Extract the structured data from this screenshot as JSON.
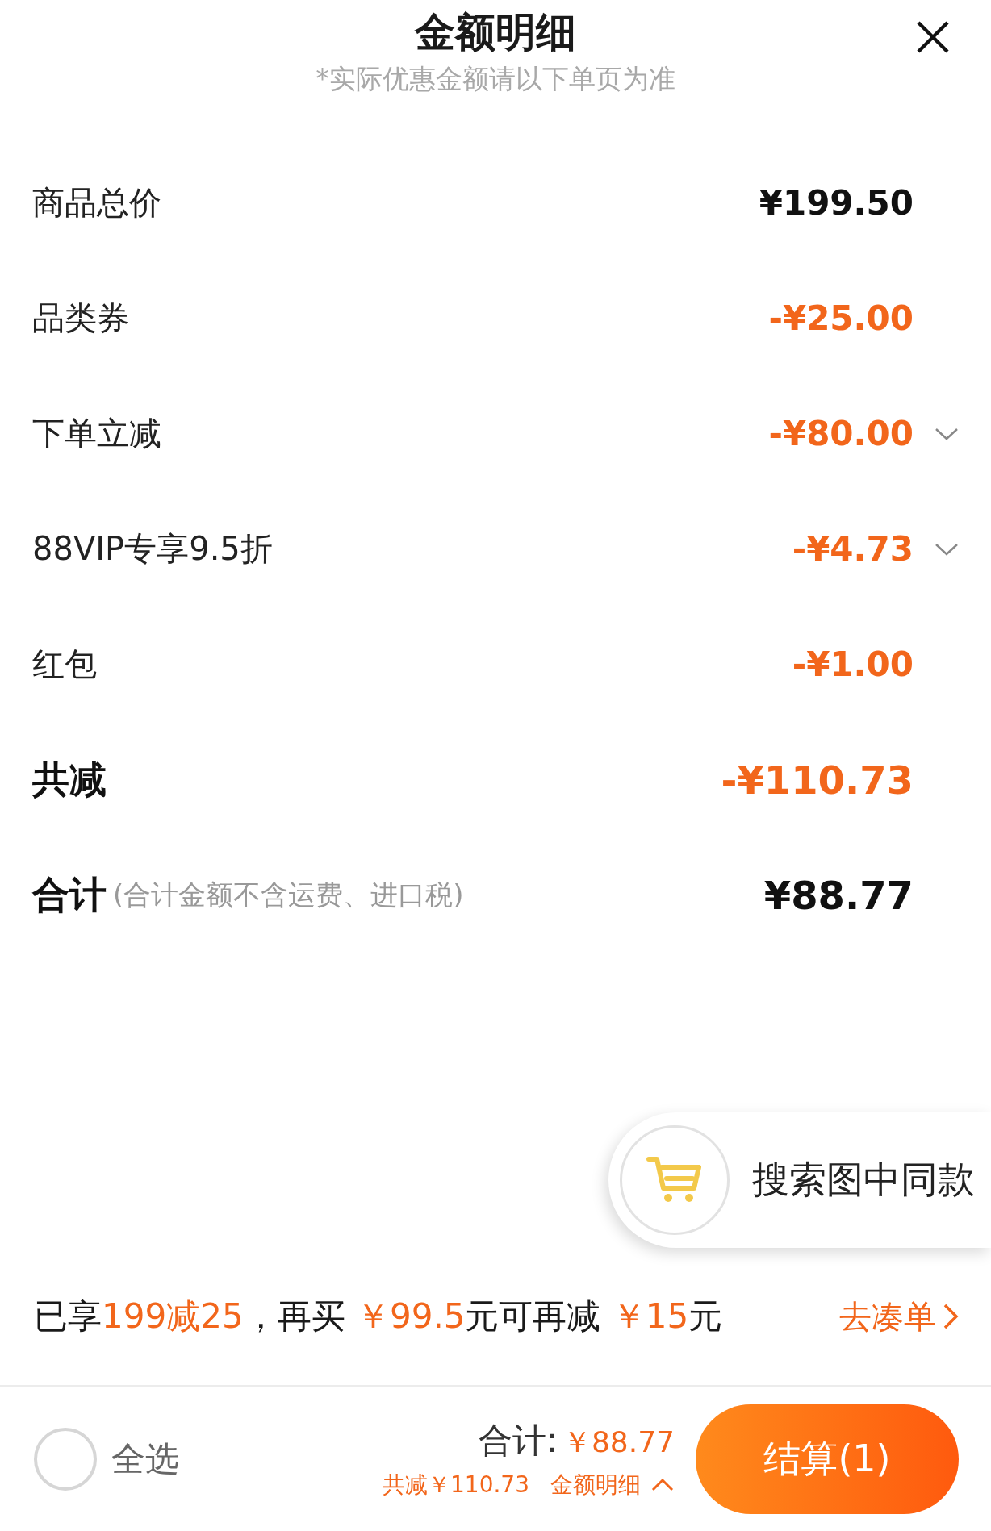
{
  "header": {
    "title": "金额明细",
    "subtitle": "*实际优惠金额请以下单页为准"
  },
  "rows": [
    {
      "label": "商品总价",
      "amount": "¥199.50",
      "kind": "price",
      "expandable": false
    },
    {
      "label": "品类券",
      "amount": "-¥25.00",
      "kind": "discount",
      "expandable": false
    },
    {
      "label": "下单立减",
      "amount": "-¥80.00",
      "kind": "discount",
      "expandable": true
    },
    {
      "label": "88VIP专享9.5折",
      "amount": "-¥4.73",
      "kind": "discount",
      "expandable": true
    },
    {
      "label": "红包",
      "amount": "-¥1.00",
      "kind": "discount",
      "expandable": false
    },
    {
      "label": "共减",
      "amount": "-¥110.73",
      "kind": "discount-total",
      "expandable": false
    },
    {
      "label": "合计",
      "note": "(合计金额不含运费、进口税)",
      "amount": "¥88.77",
      "kind": "total",
      "expandable": false
    }
  ],
  "float_button": {
    "label": "搜索图中同款"
  },
  "promo": {
    "segments": [
      {
        "text": "已享",
        "highlight": false
      },
      {
        "text": "199减25",
        "highlight": true
      },
      {
        "text": "，再买 ",
        "highlight": false
      },
      {
        "text": "￥99.5",
        "highlight": true
      },
      {
        "text": "元可再减 ",
        "highlight": false
      },
      {
        "text": "￥15",
        "highlight": true
      },
      {
        "text": "元",
        "highlight": false
      }
    ],
    "link": "去凑单"
  },
  "bottom_bar": {
    "select_all": {
      "label": "全选",
      "checked": false
    },
    "total_label": "合计:",
    "total_value": "￥88.77",
    "saved": "共减￥110.73",
    "details_link": "金额明细",
    "checkout": "结算(1)"
  }
}
